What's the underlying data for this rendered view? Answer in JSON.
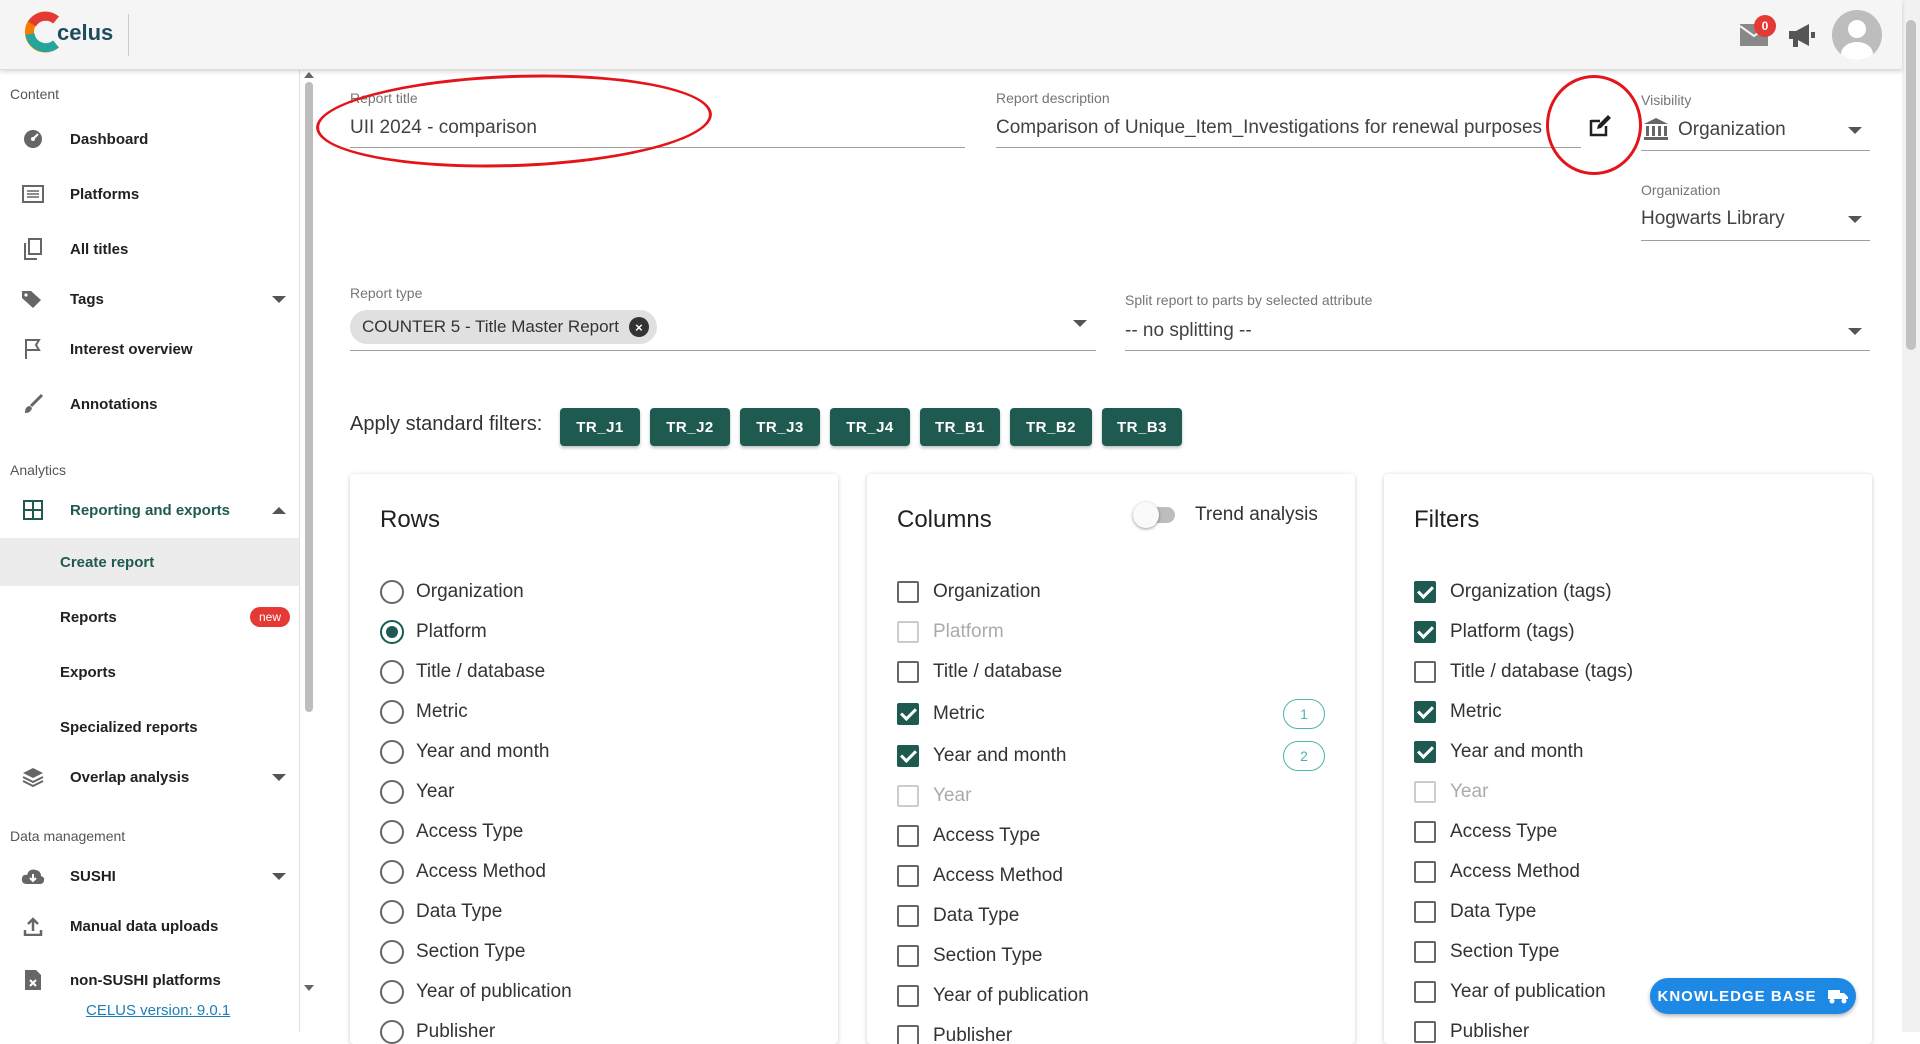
{
  "app": {
    "logo_text": "celus",
    "version_link": "CELUS version: 9.0.1"
  },
  "header": {
    "mail_badge": "0"
  },
  "sidebar": {
    "sections": {
      "content": "Content",
      "analytics": "Analytics",
      "data_management": "Data management"
    },
    "items": [
      {
        "label": "Dashboard",
        "icon": "dashboard-icon"
      },
      {
        "label": "Platforms",
        "icon": "list-icon"
      },
      {
        "label": "All titles",
        "icon": "copy-icon"
      },
      {
        "label": "Tags",
        "icon": "tag-icon"
      },
      {
        "label": "Interest overview",
        "icon": "flag-icon"
      },
      {
        "label": "Annotations",
        "icon": "brush-icon"
      },
      {
        "label": "Reporting and exports",
        "icon": "grid-icon"
      },
      {
        "label": "Create report"
      },
      {
        "label": "Reports",
        "badge": "new"
      },
      {
        "label": "Exports"
      },
      {
        "label": "Specialized reports"
      },
      {
        "label": "Overlap analysis",
        "icon": "layers-icon"
      },
      {
        "label": "SUSHI",
        "icon": "cloud-download-icon"
      },
      {
        "label": "Manual data uploads",
        "icon": "upload-icon"
      },
      {
        "label": "non-SUSHI platforms",
        "icon": "file-x-icon"
      }
    ]
  },
  "form": {
    "report_title_label": "Report title",
    "report_title_value": "UII 2024 - comparison",
    "report_description_label": "Report description",
    "report_description_value": "Comparison of Unique_Item_Investigations for renewal purposes",
    "visibility_label": "Visibility",
    "visibility_value": "Organization",
    "organization_label": "Organization",
    "organization_value": "Hogwarts Library",
    "report_type_label": "Report type",
    "report_type_value": "COUNTER 5 - Title Master Report",
    "split_label": "Split report to parts by selected attribute",
    "split_value": "-- no splitting --",
    "apply_filters_label": "Apply standard filters:",
    "standard_filters": [
      "TR_J1",
      "TR_J2",
      "TR_J3",
      "TR_J4",
      "TR_B1",
      "TR_B2",
      "TR_B3"
    ]
  },
  "rows_card": {
    "title": "Rows",
    "options": [
      {
        "label": "Organization",
        "selected": false
      },
      {
        "label": "Platform",
        "selected": true
      },
      {
        "label": "Title / database",
        "selected": false
      },
      {
        "label": "Metric",
        "selected": false
      },
      {
        "label": "Year and month",
        "selected": false
      },
      {
        "label": "Year",
        "selected": false
      },
      {
        "label": "Access Type",
        "selected": false
      },
      {
        "label": "Access Method",
        "selected": false
      },
      {
        "label": "Data Type",
        "selected": false
      },
      {
        "label": "Section Type",
        "selected": false
      },
      {
        "label": "Year of publication",
        "selected": false
      },
      {
        "label": "Publisher",
        "selected": false
      }
    ]
  },
  "columns_card": {
    "title": "Columns",
    "trend_label": "Trend analysis",
    "trend_on": false,
    "options": [
      {
        "label": "Organization",
        "checked": false,
        "disabled": false
      },
      {
        "label": "Platform",
        "checked": false,
        "disabled": true
      },
      {
        "label": "Title / database",
        "checked": false,
        "disabled": false
      },
      {
        "label": "Metric",
        "checked": true,
        "disabled": false,
        "order": "1"
      },
      {
        "label": "Year and month",
        "checked": true,
        "disabled": false,
        "order": "2"
      },
      {
        "label": "Year",
        "checked": false,
        "disabled": true
      },
      {
        "label": "Access Type",
        "checked": false,
        "disabled": false
      },
      {
        "label": "Access Method",
        "checked": false,
        "disabled": false
      },
      {
        "label": "Data Type",
        "checked": false,
        "disabled": false
      },
      {
        "label": "Section Type",
        "checked": false,
        "disabled": false
      },
      {
        "label": "Year of publication",
        "checked": false,
        "disabled": false
      },
      {
        "label": "Publisher",
        "checked": false,
        "disabled": false
      }
    ]
  },
  "filters_card": {
    "title": "Filters",
    "options": [
      {
        "label": "Organization (tags)",
        "checked": true,
        "disabled": false
      },
      {
        "label": "Platform (tags)",
        "checked": true,
        "disabled": false
      },
      {
        "label": "Title / database (tags)",
        "checked": false,
        "disabled": false
      },
      {
        "label": "Metric",
        "checked": true,
        "disabled": false
      },
      {
        "label": "Year and month",
        "checked": true,
        "disabled": false
      },
      {
        "label": "Year",
        "checked": false,
        "disabled": true
      },
      {
        "label": "Access Type",
        "checked": false,
        "disabled": false
      },
      {
        "label": "Access Method",
        "checked": false,
        "disabled": false
      },
      {
        "label": "Data Type",
        "checked": false,
        "disabled": false
      },
      {
        "label": "Section Type",
        "checked": false,
        "disabled": false
      },
      {
        "label": "Year of publication",
        "checked": false,
        "disabled": false
      },
      {
        "label": "Publisher",
        "checked": false,
        "disabled": false
      }
    ]
  },
  "knowledge_base_label": "KNOWLEDGE BASE",
  "colors": {
    "primary": "#1f5a50",
    "accent": "#1e88e5",
    "annotation": "#e3151b",
    "badge": "#e53935"
  }
}
